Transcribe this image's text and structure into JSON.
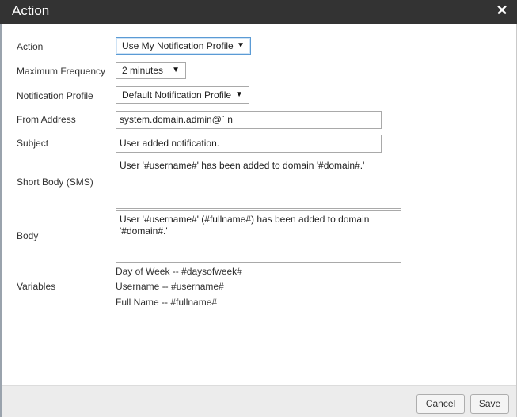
{
  "dialog": {
    "title": "Action",
    "close_glyph": "✕"
  },
  "form": {
    "action": {
      "label": "Action",
      "value": "Use My Notification Profile"
    },
    "max_frequency": {
      "label": "Maximum Frequency",
      "value": "2 minutes"
    },
    "notification_profile": {
      "label": "Notification Profile",
      "value": "Default Notification Profile"
    },
    "from_address": {
      "label": "From Address",
      "value": "system.domain.admin@`                    n"
    },
    "subject": {
      "label": "Subject",
      "value": "User added notification."
    },
    "short_body": {
      "label": "Short Body (SMS)",
      "value": "User '#username#' has been added to domain '#domain#.'"
    },
    "body": {
      "label": "Body",
      "value": "User '#username#' (#fullname#) has been added to domain '#domain#.'"
    }
  },
  "variables": {
    "label": "Variables",
    "items": [
      "Day of Week -- #daysofweek#",
      "Username -- #username#",
      "Full Name -- #fullname#"
    ]
  },
  "footer": {
    "cancel_label": "Cancel",
    "save_label": "Save"
  },
  "icons": {
    "dropdown": "chevron-down-icon",
    "close": "close-icon"
  },
  "colors": {
    "titlebar": "#333333",
    "footer": "#ececec",
    "focus_border": "#5b9bd5"
  }
}
